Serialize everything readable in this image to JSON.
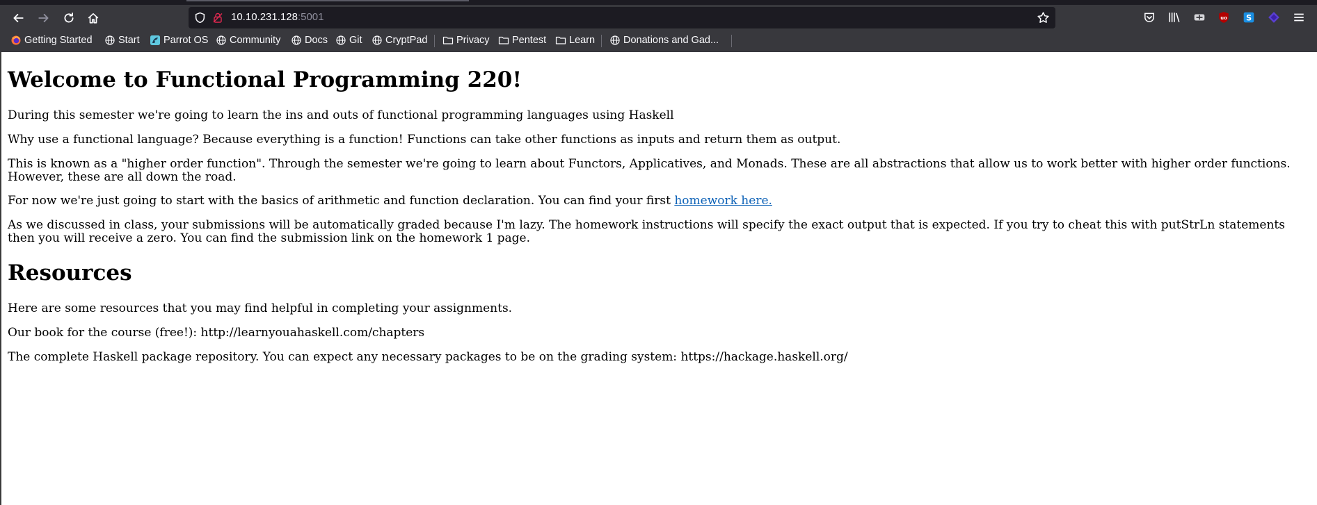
{
  "browser": {
    "url_host": "10.10.231.128",
    "url_port": ":5001",
    "bookmarks": [
      {
        "label": "Getting Started",
        "icon": "firefox-icon"
      },
      {
        "label": "Start",
        "icon": "globe-icon"
      },
      {
        "label": "Parrot OS",
        "icon": "parrot-icon"
      },
      {
        "label": "Community",
        "icon": "globe-icon"
      },
      {
        "label": "Docs",
        "icon": "globe-icon"
      },
      {
        "label": "Git",
        "icon": "globe-icon"
      },
      {
        "label": "CryptPad",
        "icon": "globe-icon"
      },
      {
        "label": "Privacy",
        "icon": "folder-icon"
      },
      {
        "label": "Pentest",
        "icon": "folder-icon"
      },
      {
        "label": "Learn",
        "icon": "folder-icon"
      },
      {
        "label": "Donations and Gad...",
        "icon": "globe-icon"
      }
    ],
    "colors": {
      "toolbar": "#38383d",
      "urlbar": "#1c1b22",
      "link": "#0d62b7"
    }
  },
  "page": {
    "heading": "Welcome to Functional Programming 220!",
    "p1": "During this semester we're going to learn the ins and outs of functional programming languages using Haskell",
    "p2": "Why use a functional language? Because everything is a function! Functions can take other functions as inputs and return them as output.",
    "p3": "This is known as a \"higher order function\". Through the semester we're going to learn about Functors, Applicatives, and Monads. These are all abstractions that allow us to work better with higher order functions. However, these are all down the road.",
    "p4_text": "For now we're just going to start with the basics of arithmetic and function declaration. You can find your first ",
    "p4_link": "homework here.",
    "p5": "As we discussed in class, your submissions will be automatically graded because I'm lazy. The homework instructions will specify the exact output that is expected. If you try to cheat this with putStrLn statements then you will receive a zero. You can find the submission link on the homework 1 page.",
    "resources_heading": "Resources",
    "r1": "Here are some resources that you may find helpful in completing your assignments.",
    "r2": "Our book for the course (free!): http://learnyouahaskell.com/chapters",
    "r3": "The complete Haskell package repository. You can expect any necessary packages to be on the grading system: https://hackage.haskell.org/"
  }
}
